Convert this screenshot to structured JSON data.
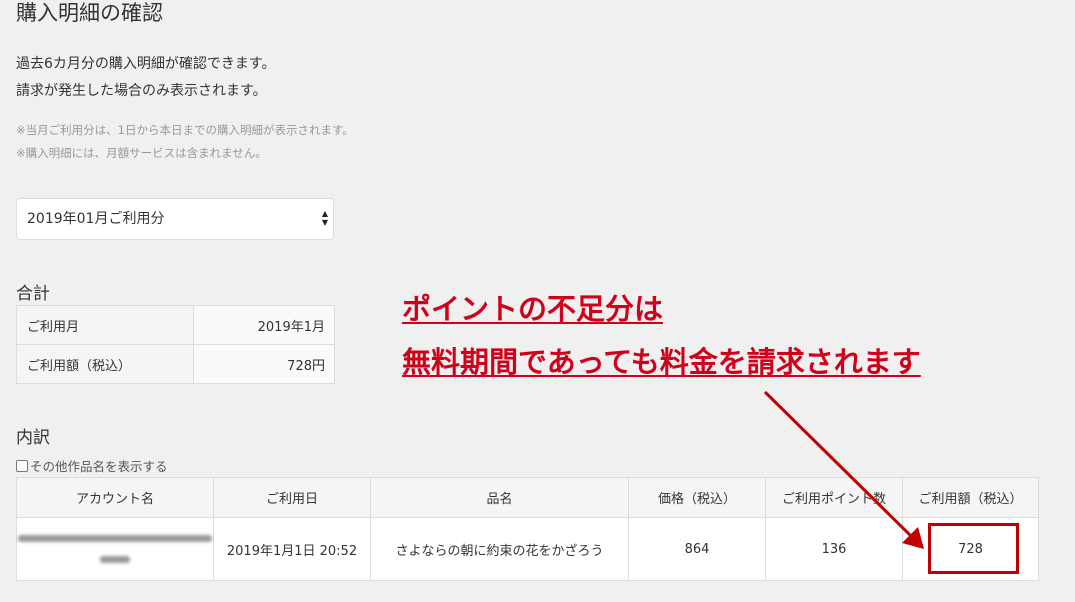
{
  "page": {
    "title": "購入明細の確認",
    "description": [
      "過去6カ月分の購入明細が確認できます。",
      "請求が発生した場合のみ表示されます。"
    ],
    "notes": [
      "※当月ご利用分は、1日から本日までの購入明細が表示されます。",
      "※購入明細には、月額サービスは含まれません。"
    ]
  },
  "month_select": {
    "value": "2019年01月ご利用分"
  },
  "summary": {
    "title": "合計",
    "rows": [
      {
        "label": "ご利用月",
        "value": "2019年1月"
      },
      {
        "label": "ご利用額（税込）",
        "value": "728円"
      }
    ]
  },
  "details": {
    "title": "内訳",
    "show_other_titles_label": "その他作品名を表示する",
    "headers": [
      "アカウント名",
      "ご利用日",
      "品名",
      "価格（税込）",
      "ご利用ポイント数",
      "ご利用額（税込）"
    ],
    "rows": [
      {
        "date": "2019年1月1日 20:52",
        "item": "さよならの朝に約束の花をかざろう",
        "price": "864",
        "points": "136",
        "amount": "728"
      }
    ]
  },
  "annotation": {
    "lines": [
      "ポイントの不足分は",
      "無料期間であっても料金を請求されます"
    ],
    "color": "#d0021b"
  }
}
